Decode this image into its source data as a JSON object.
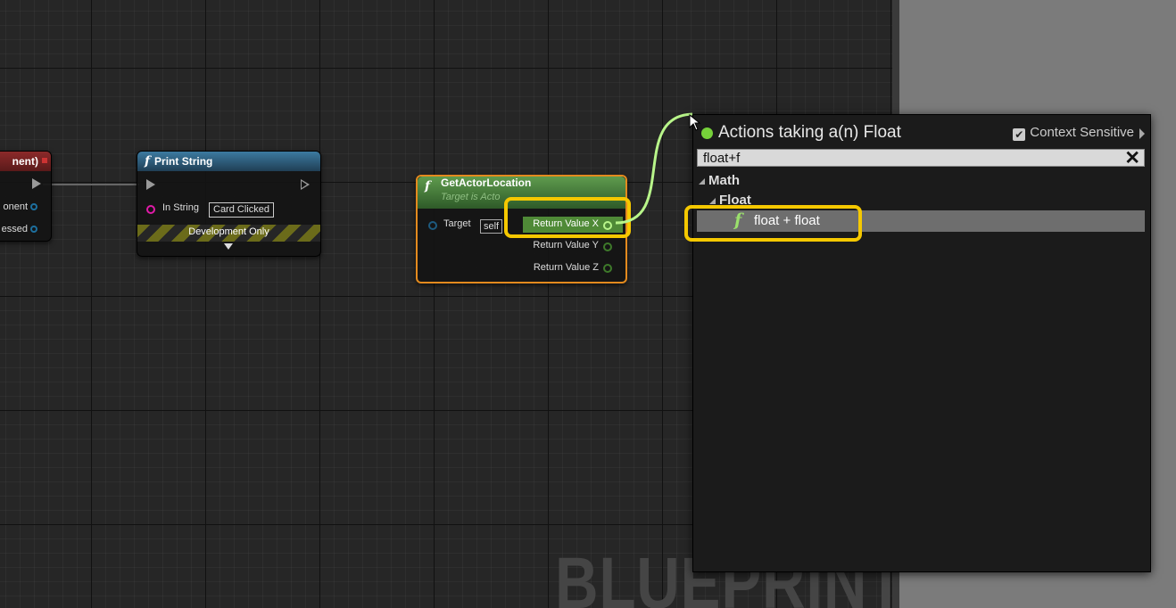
{
  "graph": {
    "watermark": "BLUEPRINT",
    "event_node": {
      "title": "nent)",
      "pins": [
        "onent",
        "essed"
      ],
      "header_color": "#7a2323"
    },
    "print_string": {
      "title": "Print String",
      "in_string_label": "In String",
      "in_string_value": "Card Clicked",
      "footer": "Development Only",
      "header_color": "#2f5f7a"
    },
    "get_actor_location": {
      "title": "GetActorLocation",
      "subtitle": "Target is Acto",
      "target_label": "Target",
      "target_value": "self",
      "outputs": [
        "Return Value X",
        "Return Value Y",
        "Return Value Z"
      ],
      "header_color": "#4d8a3f",
      "selection_color": "#e38a1e"
    },
    "wire_color": "#b8f58a"
  },
  "menu": {
    "title": "Actions taking a(n) Float",
    "context_sensitive_label": "Context Sensitive",
    "context_sensitive_checked": true,
    "search_value": "float+f",
    "categories": [
      "Math",
      "Float"
    ],
    "result": "float + float",
    "accent_color": "#76d13a"
  },
  "highlight_color": "#f5c800"
}
